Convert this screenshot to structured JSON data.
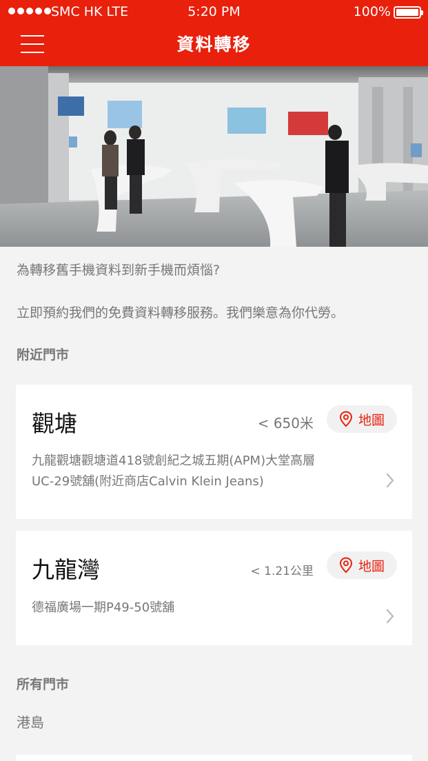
{
  "status_bar": {
    "carrier": "SMC HK LTE",
    "time": "5:20 PM",
    "battery": "100%"
  },
  "nav": {
    "title": "資料轉移",
    "menu_icon": "hamburger-menu-icon"
  },
  "intro": {
    "line1": "為轉移舊手機資料到新手機而煩惱?",
    "line2": "立即預約我們的免費資料轉移服務。我們樂意為你代勞。"
  },
  "nearby": {
    "title": "附近門市",
    "stores": [
      {
        "name": "觀塘",
        "distance": "< 650米",
        "map_label": "地圖",
        "address_line1": "九龍觀塘觀塘道418號創紀之城五期(APM)大堂高層",
        "address_line2": "UC-29號舖(附近商店Calvin Klein Jeans)"
      },
      {
        "name": "九龍灣",
        "distance": "< 1.21公里",
        "map_label": "地圖",
        "address_line1": "德福廣場一期P49-50號舖"
      }
    ]
  },
  "all_stores": {
    "title": "所有門市",
    "region": "港島"
  },
  "colors": {
    "brand": "#e8200c",
    "background": "#f3f3f3",
    "muted_text": "#777777"
  }
}
